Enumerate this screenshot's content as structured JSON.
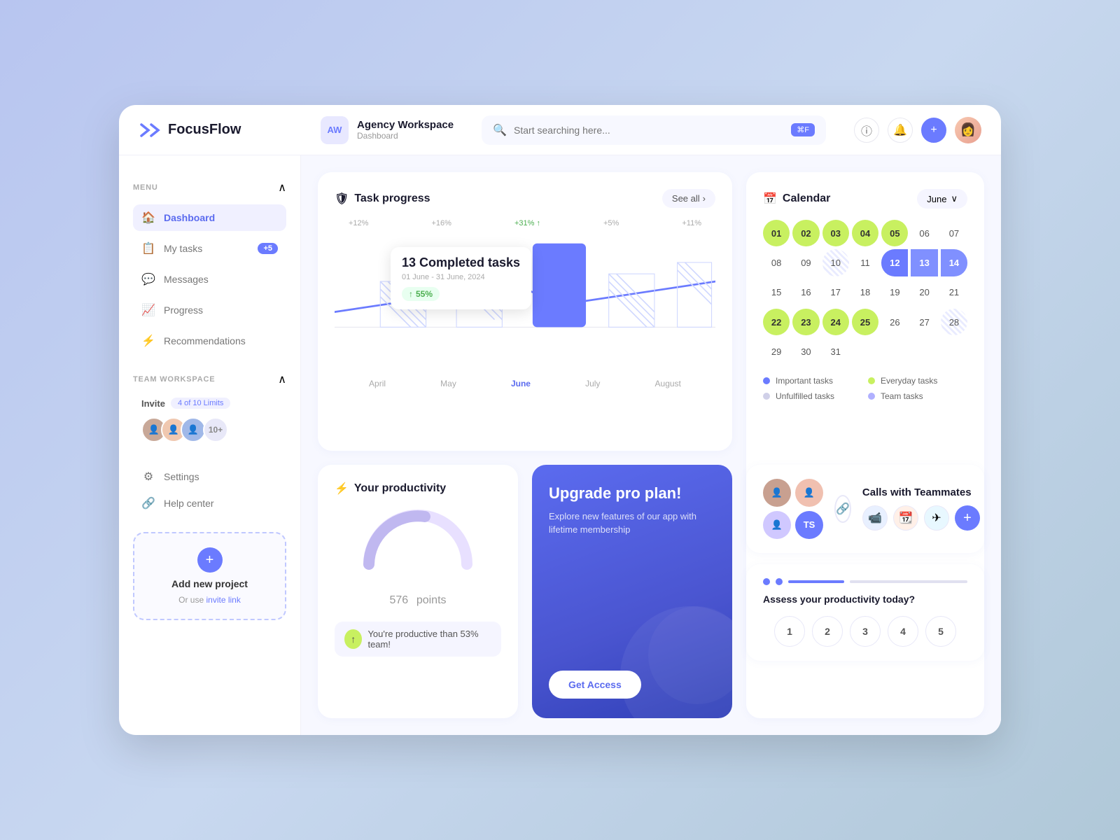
{
  "app": {
    "name": "FocusFlow",
    "logo_unicode": "✕"
  },
  "header": {
    "workspace_initials": "AW",
    "workspace_title": "Agency Workspace",
    "workspace_subtitle": "Dashboard",
    "search_placeholder": "Start searching here...",
    "shortcut": "⌘F"
  },
  "sidebar": {
    "menu_label": "MENU",
    "items": [
      {
        "id": "dashboard",
        "label": "Dashboard",
        "icon": "🏠",
        "active": true,
        "badge": null
      },
      {
        "id": "my-tasks",
        "label": "My tasks",
        "icon": "📋",
        "active": false,
        "badge": "+5"
      },
      {
        "id": "messages",
        "label": "Messages",
        "icon": "💬",
        "active": false,
        "badge": null
      },
      {
        "id": "progress",
        "label": "Progress",
        "icon": "📈",
        "active": false,
        "badge": null
      },
      {
        "id": "recommendations",
        "label": "Recommendations",
        "icon": "⚡",
        "active": false,
        "badge": null
      }
    ],
    "team_workspace_label": "TEAM WORKSPACE",
    "invite_label": "Invite",
    "invite_limit": "4 of 10 Limits",
    "avatar_count_extra": "10+",
    "settings_label": "Settings",
    "help_label": "Help center",
    "add_project_title": "Add new project",
    "add_project_subtitle": "Or use",
    "invite_link_label": "invite link"
  },
  "task_progress": {
    "title": "Task progress",
    "see_all": "See all",
    "tooltip": {
      "count": "13 Completed tasks",
      "date": "01 June - 31 June, 2024",
      "percent": "55%"
    },
    "months": [
      "April",
      "May",
      "June",
      "July",
      "August"
    ],
    "labels": [
      "+12%",
      "+16%",
      "+31%",
      "+5%",
      "+11%"
    ]
  },
  "calendar": {
    "title": "Calendar",
    "month": "June",
    "days": [
      {
        "num": "01",
        "style": "lime"
      },
      {
        "num": "02",
        "style": "lime"
      },
      {
        "num": "03",
        "style": "lime"
      },
      {
        "num": "04",
        "style": "lime"
      },
      {
        "num": "05",
        "style": "lime"
      },
      {
        "num": "06",
        "style": "normal"
      },
      {
        "num": "07",
        "style": "normal"
      },
      {
        "num": "08",
        "style": "normal"
      },
      {
        "num": "09",
        "style": "normal"
      },
      {
        "num": "10",
        "style": "hatched"
      },
      {
        "num": "11",
        "style": "normal"
      },
      {
        "num": "12",
        "style": "today"
      },
      {
        "num": "13",
        "style": "today-range"
      },
      {
        "num": "14",
        "style": "today-range-end"
      },
      {
        "num": "15",
        "style": "normal"
      },
      {
        "num": "16",
        "style": "normal"
      },
      {
        "num": "17",
        "style": "normal"
      },
      {
        "num": "18",
        "style": "normal"
      },
      {
        "num": "19",
        "style": "normal"
      },
      {
        "num": "20",
        "style": "normal"
      },
      {
        "num": "21",
        "style": "normal"
      },
      {
        "num": "22",
        "style": "lime"
      },
      {
        "num": "23",
        "style": "lime"
      },
      {
        "num": "24",
        "style": "lime"
      },
      {
        "num": "25",
        "style": "lime"
      },
      {
        "num": "26",
        "style": "normal"
      },
      {
        "num": "27",
        "style": "normal"
      },
      {
        "num": "28",
        "style": "hatched"
      },
      {
        "num": "29",
        "style": "normal"
      },
      {
        "num": "30",
        "style": "normal"
      },
      {
        "num": "31",
        "style": "normal"
      }
    ],
    "legend": [
      {
        "label": "Important tasks",
        "color": "#6b7bff"
      },
      {
        "label": "Everyday tasks",
        "color": "#c8f060"
      },
      {
        "label": "Unfulfilled tasks",
        "color": "#d0d0e8"
      },
      {
        "label": "Team tasks",
        "color": "#b0b0ff"
      }
    ]
  },
  "productivity": {
    "title": "Your productivity",
    "points": "576",
    "points_label": "points",
    "badge_text": "You're productive than 53% team!"
  },
  "upgrade": {
    "title": "Upgrade pro plan!",
    "description": "Explore new features of our app with lifetime membership",
    "button_label": "Get Access"
  },
  "calls": {
    "title": "Calls with Teammates",
    "apps": [
      "📹",
      "🗓",
      "✈"
    ]
  },
  "assess": {
    "title": "Assess your productivity today?",
    "numbers": [
      "1",
      "2",
      "3",
      "4",
      "5"
    ]
  }
}
